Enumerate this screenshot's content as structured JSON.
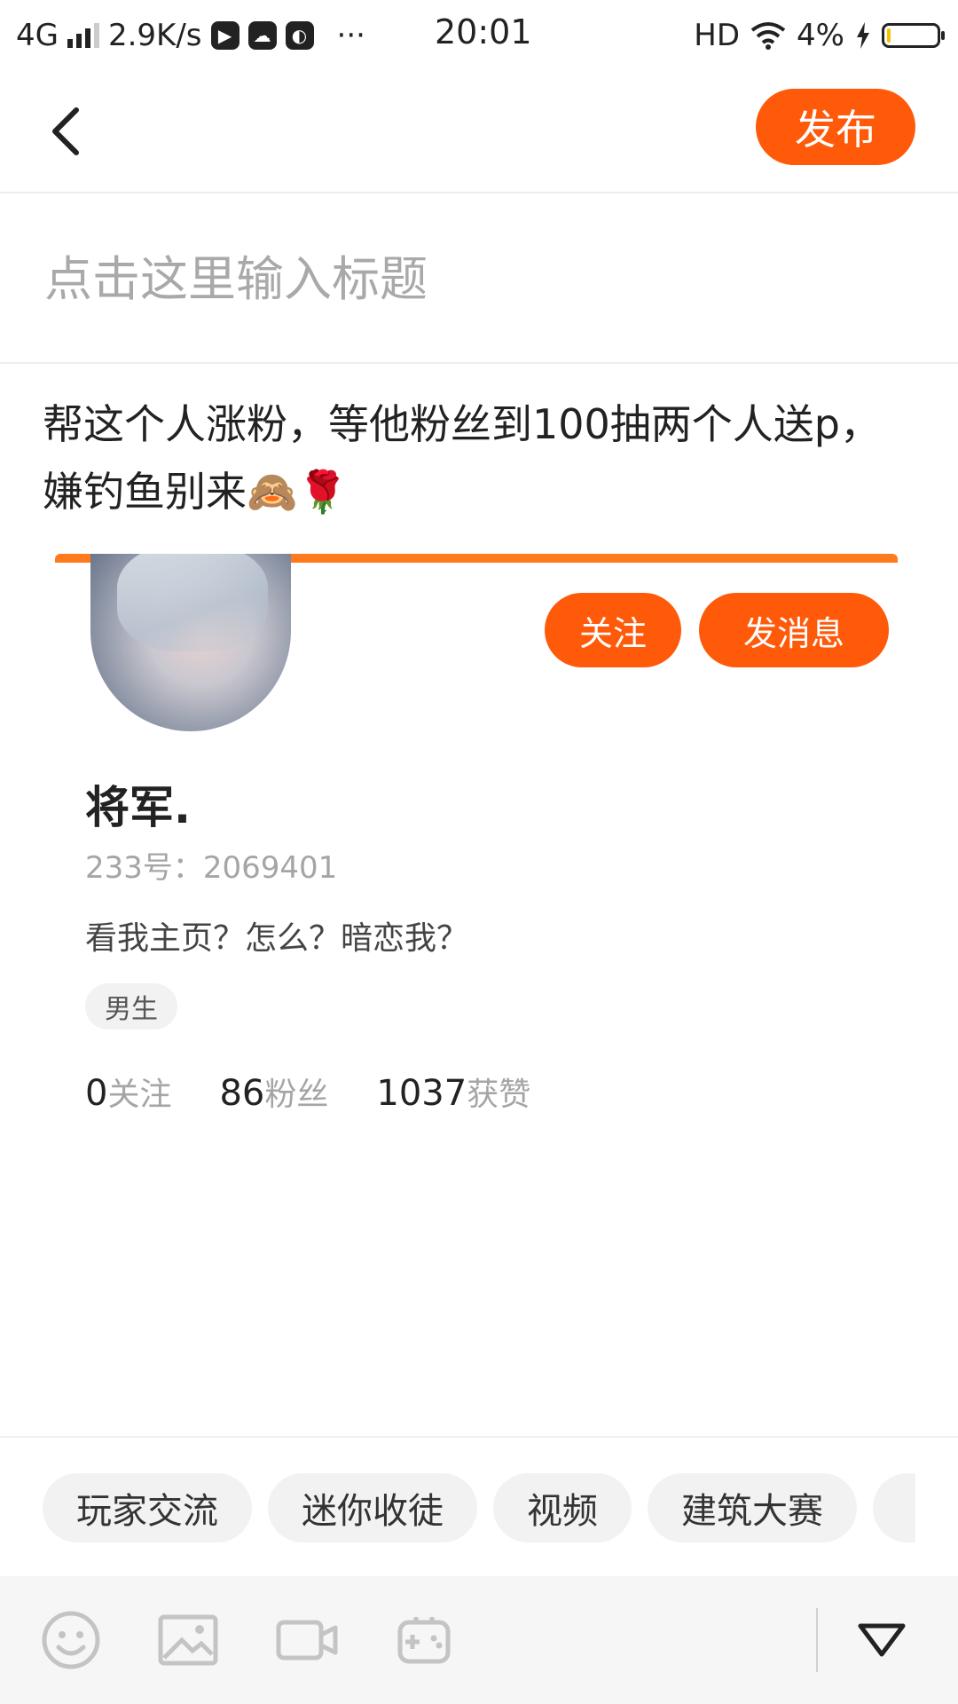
{
  "status_bar": {
    "network": "4G",
    "speed": "2.9K/s",
    "more": "···",
    "time": "20:01",
    "hd": "HD",
    "battery": "4%",
    "battery_level": 0.04
  },
  "header": {
    "publish_label": "发布"
  },
  "title_input": {
    "placeholder": "点击这里输入标题",
    "value": ""
  },
  "content": {
    "text": "帮这个人涨粉，等他粉丝到100抽两个人送p，嫌钓鱼别来🙈🌹"
  },
  "profile_card": {
    "follow_label": "关注",
    "message_label": "发消息",
    "username": "将军.",
    "user_id": "233号：2069401",
    "bio": "看我主页？怎么？暗恋我？",
    "gender_tag": "男生",
    "stats": [
      {
        "num": "0",
        "label": "关注"
      },
      {
        "num": "86",
        "label": "粉丝"
      },
      {
        "num": "1037",
        "label": "获赞"
      }
    ]
  },
  "topics": [
    "玩家交流",
    "迷你收徒",
    "视频",
    "建筑大赛",
    ""
  ],
  "toolbar": {
    "icons": [
      "emoji-icon",
      "image-icon",
      "video-icon",
      "gamepad-icon",
      "collapse-icon"
    ]
  },
  "colors": {
    "accent": "#ff5a0a",
    "card_bar": "#ff7a1c",
    "muted": "#a5a5a5"
  }
}
